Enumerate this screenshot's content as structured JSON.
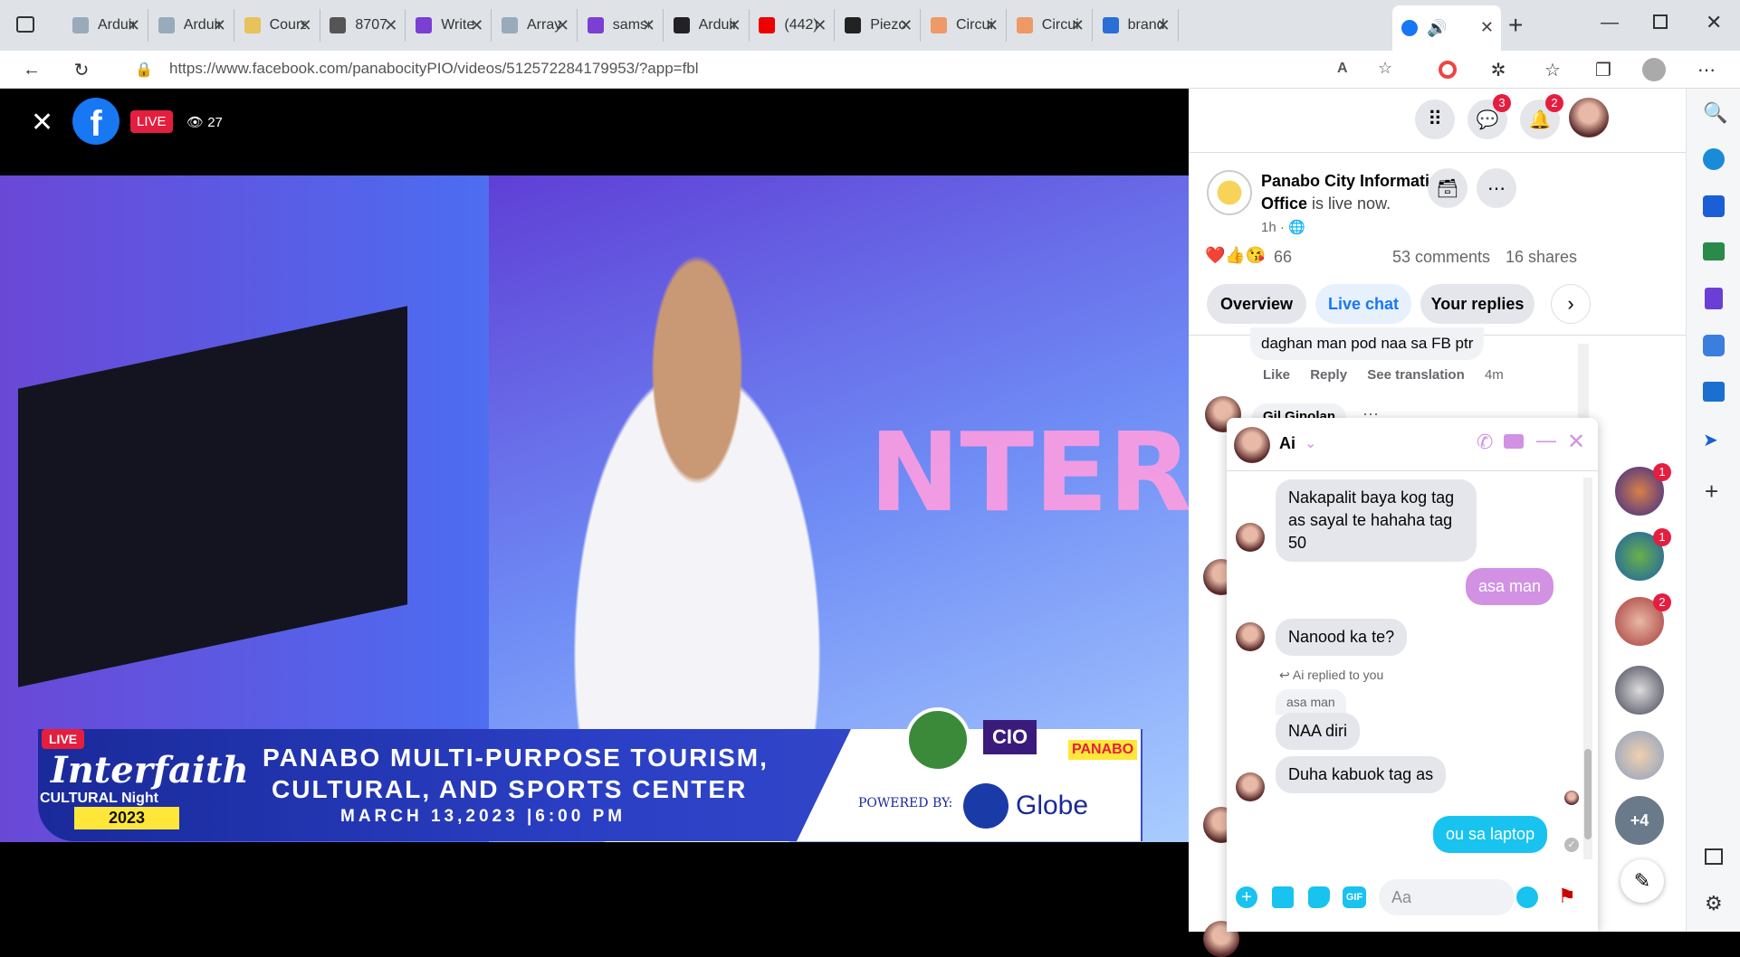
{
  "browser": {
    "tabs": [
      {
        "label": "Arduino",
        "color": "#9ab"
      },
      {
        "label": "Arduino",
        "color": "#9ab"
      },
      {
        "label": "Course",
        "color": "#e8c25a"
      },
      {
        "label": "8707",
        "color": "#555"
      },
      {
        "label": "Write",
        "color": "#7b3fd1"
      },
      {
        "label": "Array",
        "color": "#9ab"
      },
      {
        "label": "samsung",
        "color": "#7b3fd1"
      },
      {
        "label": "Arduino",
        "color": "#222"
      },
      {
        "label": "(442)",
        "color": "#e00"
      },
      {
        "label": "Piezo",
        "color": "#222"
      },
      {
        "label": "Circuit",
        "color": "#e96"
      },
      {
        "label": "Circuit",
        "color": "#e96"
      },
      {
        "label": "brand",
        "color": "#2a6fd6"
      }
    ],
    "url": "https://www.facebook.com/panabocityPIO/videos/512572284179953/?app=fbl",
    "url_host": "www.facebook.com"
  },
  "video": {
    "live_label": "LIVE",
    "viewers": "27",
    "overlay": {
      "live_tag": "LIVE",
      "event_line1": "Interfaith",
      "event_line2": "CULTURAL Night",
      "event_year": "2023",
      "venue_line1": "PANABO MULTI-PURPOSE TOURISM,",
      "venue_line2": "CULTURAL, AND SPORTS CENTER",
      "date": "MARCH 13,2023 |6:00 PM",
      "powered_by": "POWERED BY:",
      "sponsor": "Globe",
      "city": "PANABO",
      "cio": "CIO"
    }
  },
  "topnav": {
    "messenger_badge": "3",
    "notif_badge": "2"
  },
  "post": {
    "page_name": "Panabo City Information Office",
    "status": "is live now.",
    "time": "1h ·",
    "reactions_count": "66",
    "comments": "53 comments",
    "shares": "16 shares",
    "tabs": [
      "Overview",
      "Live chat",
      "Your replies"
    ],
    "comment_text": "daghan man pod naa sa FB ptr",
    "comment_actions": [
      "Like",
      "Reply",
      "See translation",
      "4m"
    ],
    "next_commenter": "Gil Ginolan"
  },
  "chat": {
    "name": "Ai",
    "messages": [
      {
        "text": "Nakapalit baya kog tag as sayal te hahaha tag 50",
        "from": "them"
      },
      {
        "text": "asa man",
        "from": "me"
      },
      {
        "text": "Nanood ka te?",
        "from": "them"
      },
      {
        "reply_note": "Ai replied to you",
        "quoted": "asa man",
        "text": "NAA diri",
        "from": "them"
      },
      {
        "text": "Duha kabuok tag as",
        "from": "them"
      },
      {
        "text": "ou sa laptop",
        "from": "me"
      }
    ],
    "input_placeholder": "Aa"
  },
  "contacts": {
    "badges": [
      "1",
      "1",
      "2"
    ],
    "more": "+4"
  }
}
